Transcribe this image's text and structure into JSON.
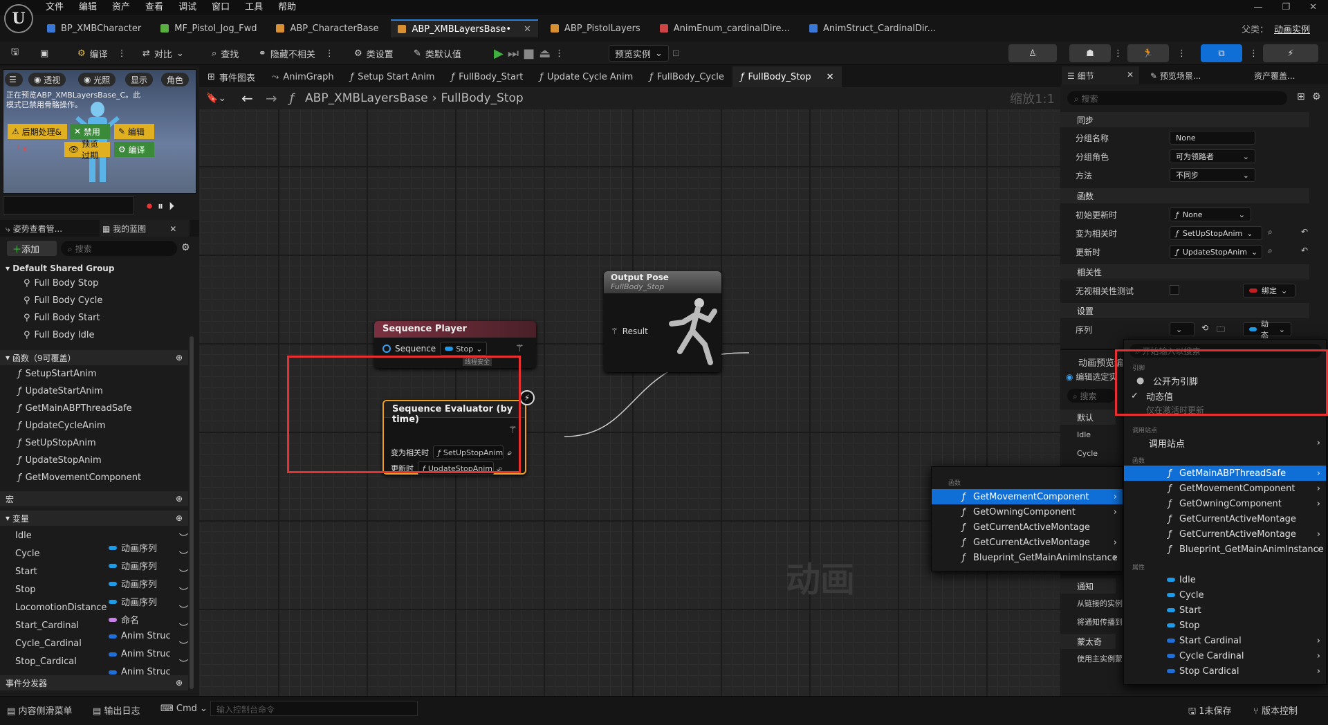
{
  "menubar": {
    "items": [
      "文件",
      "编辑",
      "资产",
      "查看",
      "调试",
      "窗口",
      "工具",
      "帮助"
    ]
  },
  "tabs": [
    {
      "label": "BP_XMBCharacter",
      "color": "#3a78d8"
    },
    {
      "label": "MF_Pistol_Jog_Fwd",
      "color": "#59b040"
    },
    {
      "label": "ABP_CharacterBase",
      "color": "#d89030"
    },
    {
      "label": "ABP_XMBLayersBase•",
      "color": "#d89030"
    },
    {
      "label": "ABP_PistolLayers",
      "color": "#d89030"
    },
    {
      "label": "AnimEnum_cardinalDire...",
      "color": "#cc4444"
    },
    {
      "label": "AnimStruct_CardinalDir...",
      "color": "#3a78d8"
    }
  ],
  "parent_label": "父类：",
  "parent_value": "动画实例",
  "toolbar": {
    "compile": "编译",
    "diff": "对比",
    "find": "查找",
    "hide": "隐藏不相关",
    "class_settings": "类设置",
    "class_defaults": "类默认值",
    "preview": "预览实例"
  },
  "viewport": {
    "btn_persp": "透视",
    "btn_lit": "光照",
    "btn_show": "显示",
    "btn_role": "角色",
    "warning": "正在预览ABP_XMBLayersBase_C。此模式已禁用骨骼操作。",
    "post_process": "后期处理&",
    "disable": "禁用",
    "edit": "编辑",
    "preview_override": "预览过期",
    "compile": "编译"
  },
  "left": {
    "tab1": "姿势查看管...",
    "tab2": "我的蓝图",
    "add": "添加",
    "search": "搜索",
    "group": "Default Shared Group",
    "graphs": [
      "Full Body Stop",
      "Full Body Cycle",
      "Full Body Start",
      "Full Body Idle"
    ],
    "functions_header": "函数（9可覆盖）",
    "functions": [
      "SetupStartAnim",
      "UpdateStartAnim",
      "GetMainABPThreadSafe",
      "UpdateCycleAnim",
      "SetUpStopAnim",
      "UpdateStopAnim",
      "GetMovementComponent"
    ],
    "macros_header": "宏",
    "variables_header": "变量",
    "variables": [
      {
        "name": "Idle",
        "type": "动画序列",
        "color": "#1e9be8"
      },
      {
        "name": "Cycle",
        "type": "动画序列",
        "color": "#1e9be8"
      },
      {
        "name": "Start",
        "type": "动画序列",
        "color": "#1e9be8"
      },
      {
        "name": "Stop",
        "type": "动画序列",
        "color": "#1e9be8"
      },
      {
        "name": "LocomotionDistance",
        "type": "命名",
        "color": "#c880e8"
      },
      {
        "name": "Start_Cardinal",
        "type": "Anim Struc",
        "color": "#1e6fd8"
      },
      {
        "name": "Cycle_Cardinal",
        "type": "Anim Struc",
        "color": "#1e6fd8"
      },
      {
        "name": "Stop_Cardical",
        "type": "Anim Struc",
        "color": "#1e6fd8"
      }
    ],
    "dispatchers_header": "事件分发器"
  },
  "graph": {
    "tabs": [
      "事件图表",
      "AnimGraph",
      "Setup Start Anim",
      "FullBody_Start",
      "Update Cycle Anim",
      "FullBody_Cycle",
      "FullBody_Stop"
    ],
    "breadcrumb_root": "ABP_XMBLayersBase",
    "breadcrumb_leaf": "FullBody_Stop",
    "zoom": "缩放1:1",
    "watermark": "动画",
    "seq_player": {
      "title": "Sequence Player",
      "pin": "Sequence",
      "value": "Stop",
      "badge": "线程安全"
    },
    "seq_eval": {
      "title": "Sequence Evaluator (by time)",
      "row1_label": "变为相关时",
      "row1_value": "SetUpStopAnim",
      "row2_label": "更新时",
      "row2_value": "UpdateStopAnim"
    },
    "output": {
      "title": "Output Pose",
      "subtitle": "FullBody_Stop",
      "pin": "Result"
    }
  },
  "right": {
    "tab_details": "细节",
    "tab_preview": "预览场景...",
    "tab_asset": "资产覆盖...",
    "search": "搜索",
    "cat_sync": "同步",
    "sync_group_name": "分组名称",
    "sync_group_value": "None",
    "sync_role": "分组角色",
    "sync_role_value": "可为领路者",
    "method": "方法",
    "method_value": "不同步",
    "cat_func": "函数",
    "initial_update": "初始更新时",
    "initial_value": "None",
    "become_relevant": "变为相关时",
    "become_value": "SetUpStopAnim",
    "update": "更新时",
    "update_value": "UpdateStopAnim",
    "cat_relev": "相关性",
    "ignore_relev": "无视相关性测试",
    "bind": "绑定",
    "cat_settings": "设置",
    "sequence": "序列",
    "dynamic": "动态",
    "anim_preview": "动画预览编",
    "edit_preset": "编辑选定实",
    "search2": "搜索",
    "cat_default": "默认",
    "def_idle": "Idle",
    "def_cycle": "Cycle",
    "cat_notify": "通知",
    "notify1": "从链接的实例",
    "notify2": "将通知传播到",
    "cat_montage": "蒙太奇",
    "montage1": "使用主实例蒙"
  },
  "popup_main": {
    "search_placeholder": "开始输入以搜索",
    "hdr_pin": "引脚",
    "expose_pin": "公开为引脚",
    "dynamic_value": "动态值",
    "only_when_active": "仅在激活时更新",
    "hdr_call_site": "调用站点",
    "call_site": "调用站点",
    "hdr_functions": "函数",
    "functions": [
      "GetMainABPThreadSafe",
      "GetMovementComponent",
      "GetOwningComponent",
      "GetCurrentActiveMontage",
      "GetCurrentActiveMontage",
      "Blueprint_GetMainAnimInstance"
    ],
    "hdr_props": "属性",
    "props": [
      "Idle",
      "Cycle",
      "Start",
      "Stop",
      "Start Cardinal",
      "Cycle Cardinal",
      "Stop Cardical"
    ]
  },
  "popup_sub": {
    "hdr": "函数",
    "items": [
      "GetMovementComponent",
      "GetOwningComponent",
      "GetCurrentActiveMontage",
      "GetCurrentActiveMontage",
      "Blueprint_GetMainAnimInstance"
    ]
  },
  "status": {
    "drawer": "内容侧滑菜单",
    "log": "输出日志",
    "cmd": "Cmd",
    "cmd_placeholder": "输入控制台命令",
    "unsaved": "1未保存",
    "source": "版本控制"
  }
}
